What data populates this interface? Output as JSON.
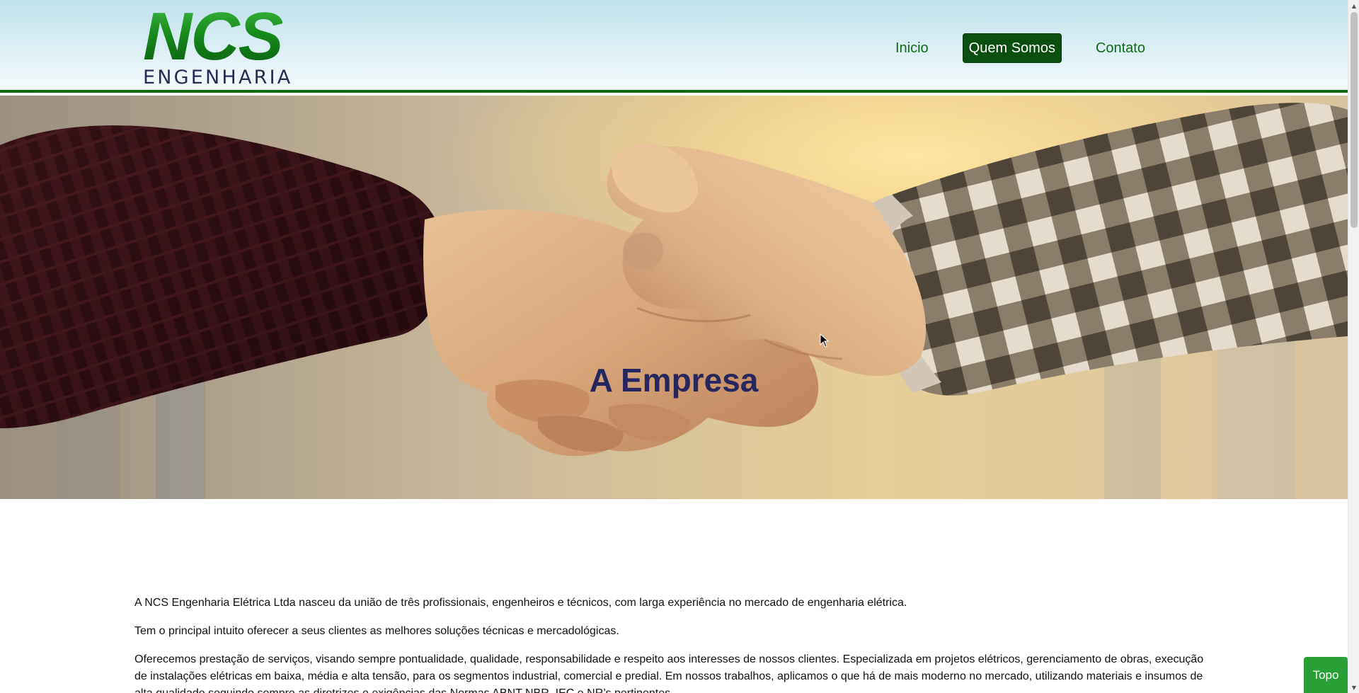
{
  "brand": {
    "name": "NCS",
    "subtitle": "ENGENHARIA"
  },
  "nav": {
    "items": [
      {
        "label": "Inicio",
        "active": false
      },
      {
        "label": "Quem Somos",
        "active": true
      },
      {
        "label": "Contato",
        "active": false
      }
    ]
  },
  "hero": {
    "title": "A Empresa",
    "scroll_icon": "chevron-down-icon"
  },
  "content": {
    "paragraphs": [
      "A NCS Engenharia Elétrica Ltda nasceu da união de três profissionais, engenheiros e técnicos, com larga experiência no mercado de engenharia elétrica.",
      "Tem o principal intuito oferecer a seus clientes as melhores soluções técnicas e mercadológicas.",
      "Oferecemos prestação de serviços, visando sempre pontualidade, qualidade, responsabilidade e respeito aos interesses de nossos clientes. Especializada em projetos elétricos, gerenciamento de obras, execução de instalações elétricas em baixa, média e alta tensão, para os segmentos industrial, comercial e predial. Em nossos trabalhos, aplicamos o que há de mais moderno no mercado, utilizando materiais e insumos de alta qualidade seguindo sempre as diretrizes e exigências das Normas ABNT NBR, IEC e NR’s pertinentes."
    ]
  },
  "back_to_top": {
    "label": "Topo"
  },
  "colors": {
    "brand_green": "#0e6a14",
    "active_nav": "#0a4f0f",
    "hero_title": "#27275f",
    "topo_button": "#28a035"
  }
}
